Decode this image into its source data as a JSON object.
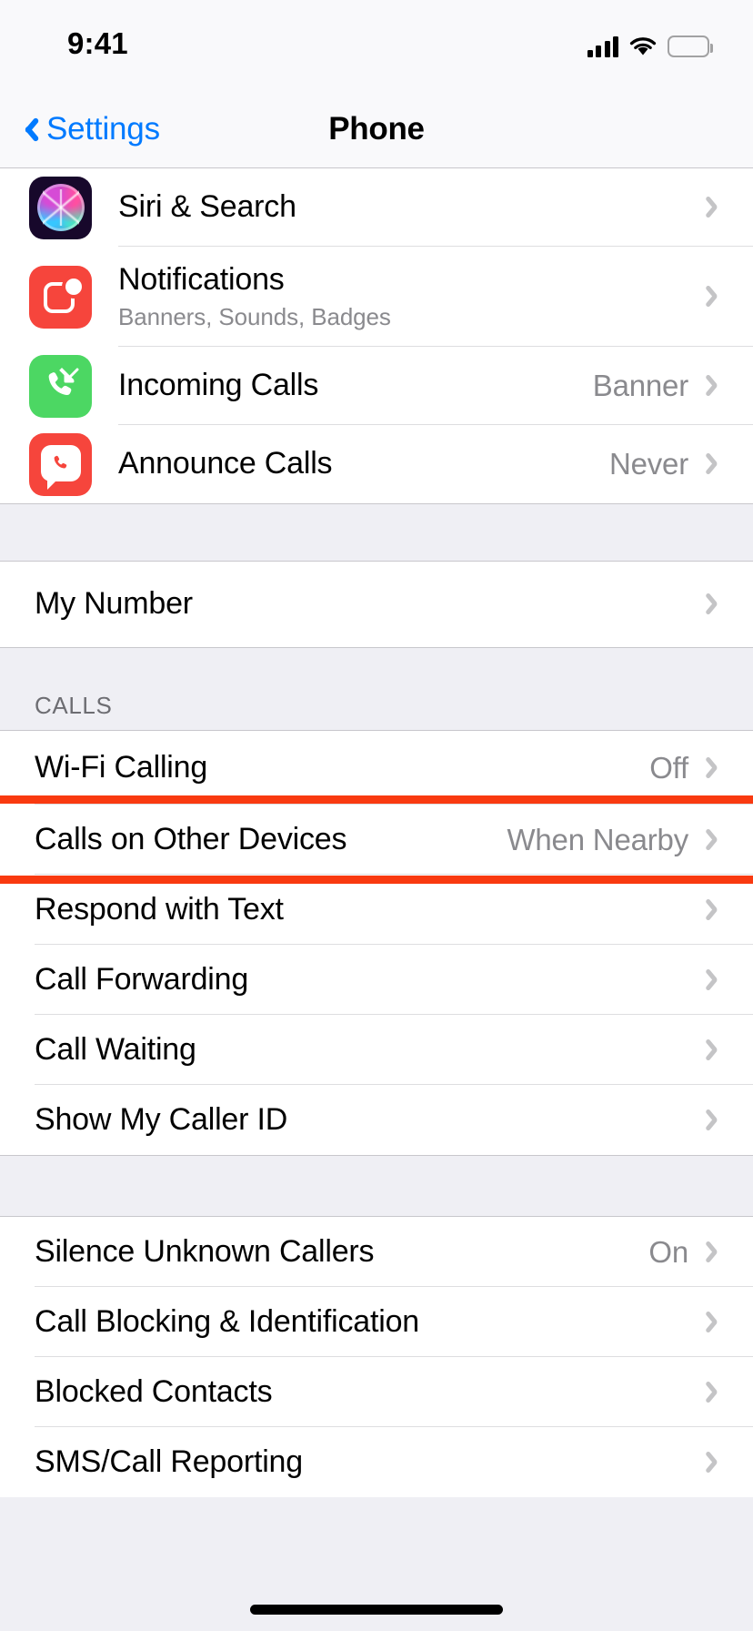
{
  "status_bar": {
    "time": "9:41",
    "icons": [
      "cellular-signal-icon",
      "wifi-icon",
      "battery-icon"
    ]
  },
  "nav_bar": {
    "back_label": "Settings",
    "back_icon": "chevron-left-icon",
    "title": "Phone"
  },
  "accent_colors": {
    "tint_blue": "#007AFF",
    "highlight_red": "#F93A10",
    "siri_dark": "#17082b",
    "notifications_red": "#F6453C",
    "incoming_green": "#4CD763",
    "announce_red": "#F6453C",
    "value_gray": "#8A8A8E",
    "chevron_gray": "#C4C4C6",
    "group_background": "#EFEFF4",
    "row_background": "#FFFFFF",
    "separator": "#C8C7CC"
  },
  "sections": [
    {
      "header": "",
      "rows": [
        {
          "label": "Siri & Search",
          "subtitle": "",
          "value": "",
          "icon": "siri-icon",
          "accessory": "chevron-right-icon"
        },
        {
          "label": "Notifications",
          "subtitle": "Banners, Sounds, Badges",
          "value": "",
          "icon": "notifications-icon",
          "accessory": "chevron-right-icon"
        },
        {
          "label": "Incoming Calls",
          "subtitle": "",
          "value": "Banner",
          "icon": "incoming-calls-icon",
          "accessory": "chevron-right-icon"
        },
        {
          "label": "Announce Calls",
          "subtitle": "",
          "value": "Never",
          "icon": "announce-calls-icon",
          "accessory": "chevron-right-icon"
        }
      ]
    },
    {
      "header": "",
      "rows": [
        {
          "label": "My Number",
          "subtitle": "",
          "value": "",
          "icon": "",
          "accessory": "chevron-right-icon"
        }
      ]
    },
    {
      "header": "CALLS",
      "rows": [
        {
          "label": "Wi-Fi Calling",
          "subtitle": "",
          "value": "Off",
          "icon": "",
          "accessory": "chevron-right-icon"
        },
        {
          "label": "Calls on Other Devices",
          "subtitle": "",
          "value": "When Nearby",
          "icon": "",
          "accessory": "chevron-right-icon",
          "highlighted": true
        },
        {
          "label": "Respond with Text",
          "subtitle": "",
          "value": "",
          "icon": "",
          "accessory": "chevron-right-icon"
        },
        {
          "label": "Call Forwarding",
          "subtitle": "",
          "value": "",
          "icon": "",
          "accessory": "chevron-right-icon"
        },
        {
          "label": "Call Waiting",
          "subtitle": "",
          "value": "",
          "icon": "",
          "accessory": "chevron-right-icon"
        },
        {
          "label": "Show My Caller ID",
          "subtitle": "",
          "value": "",
          "icon": "",
          "accessory": "chevron-right-icon"
        }
      ]
    },
    {
      "header": "",
      "rows": [
        {
          "label": "Silence Unknown Callers",
          "subtitle": "",
          "value": "On",
          "icon": "",
          "accessory": "chevron-right-icon"
        },
        {
          "label": "Call Blocking & Identification",
          "subtitle": "",
          "value": "",
          "icon": "",
          "accessory": "chevron-right-icon"
        },
        {
          "label": "Blocked Contacts",
          "subtitle": "",
          "value": "",
          "icon": "",
          "accessory": "chevron-right-icon"
        },
        {
          "label": "SMS/Call Reporting",
          "subtitle": "",
          "value": "",
          "icon": "",
          "accessory": "chevron-right-icon"
        }
      ]
    }
  ],
  "home_indicator": "home-indicator"
}
